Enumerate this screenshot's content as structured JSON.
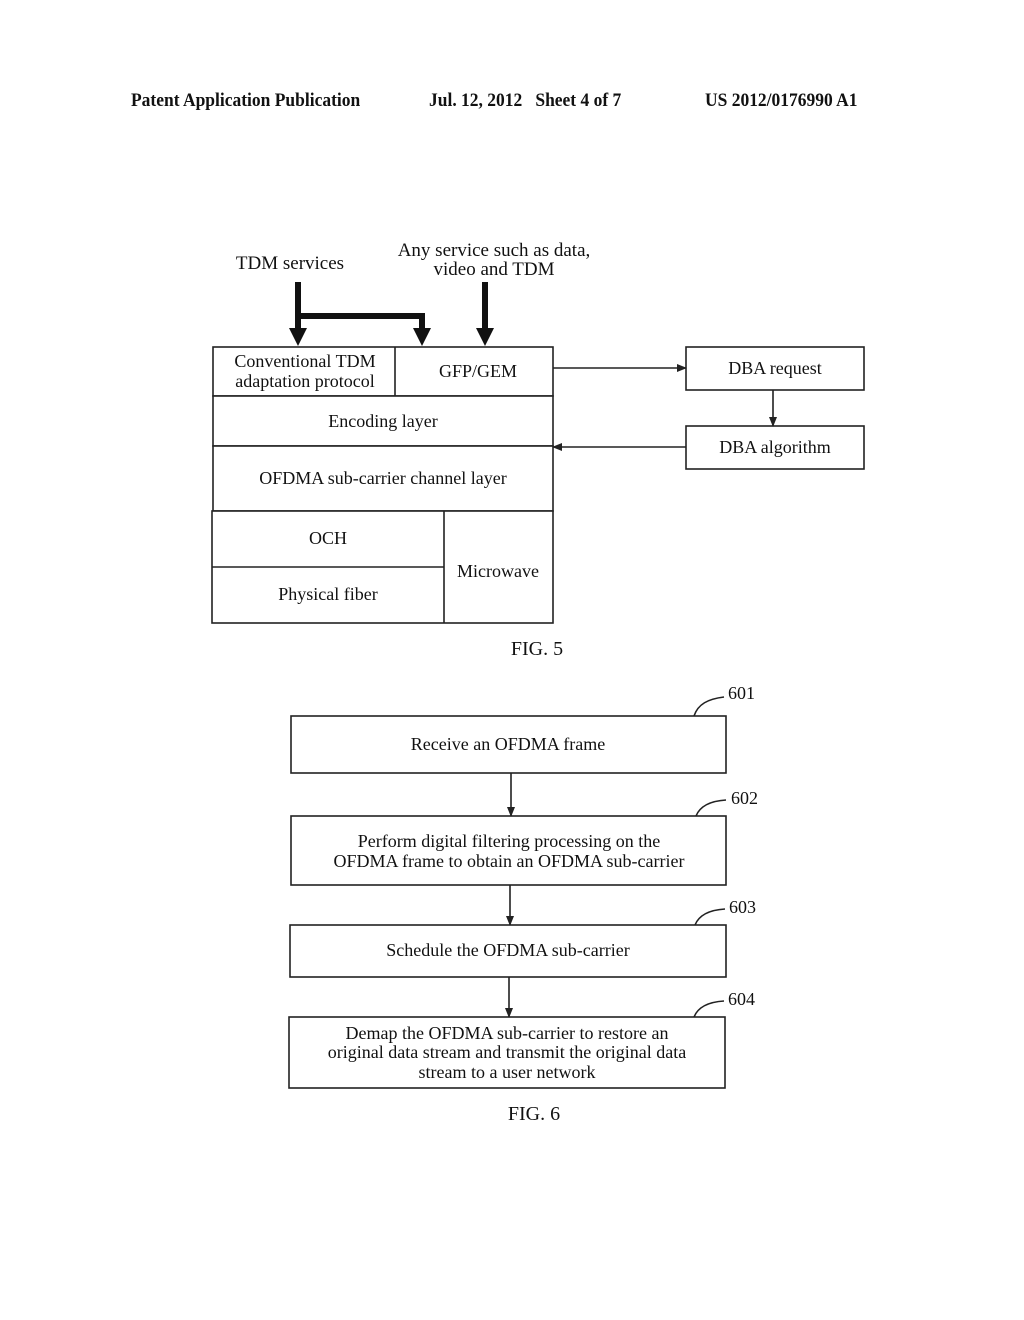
{
  "header": {
    "publication": "Patent Application Publication",
    "date_sheet": "Jul. 12, 2012   Sheet 4 of 7",
    "number": "US 2012/0176990 A1"
  },
  "fig5": {
    "caption": "FIG. 5",
    "inputs": {
      "tdm_services": "TDM services",
      "any_service_line1": "Any service such as data,",
      "any_service_line2": "video and TDM"
    },
    "stack": {
      "tdm_adaptation_line1": "Conventional TDM",
      "tdm_adaptation_line2": "adaptation protocol",
      "gfp_gem": "GFP/GEM",
      "encoding_layer": "Encoding layer",
      "ofdma_layer": "OFDMA sub-carrier channel layer",
      "och": "OCH",
      "physical_fiber": "Physical fiber",
      "microwave": "Microwave"
    },
    "dba": {
      "request": "DBA request",
      "algorithm": "DBA algorithm"
    }
  },
  "fig6": {
    "caption": "FIG. 6",
    "steps": [
      {
        "ref": "601",
        "lines": [
          "Receive an OFDMA frame"
        ]
      },
      {
        "ref": "602",
        "lines": [
          "Perform digital filtering processing on the",
          "OFDMA frame to obtain an OFDMA sub-carrier"
        ]
      },
      {
        "ref": "603",
        "lines": [
          "Schedule the OFDMA sub-carrier"
        ]
      },
      {
        "ref": "604",
        "lines": [
          "Demap the OFDMA sub-carrier to restore an",
          "original data stream and transmit the original data",
          "stream to a user network"
        ]
      }
    ]
  }
}
